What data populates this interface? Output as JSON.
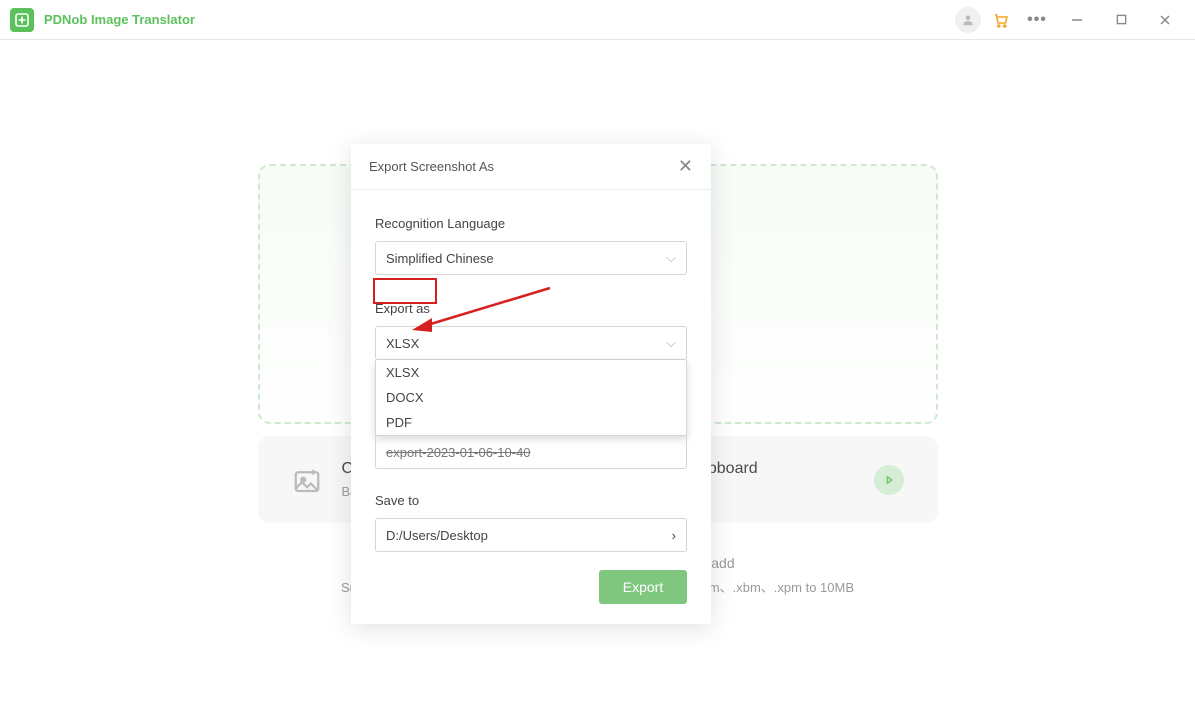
{
  "app": {
    "title": "PDNob Image Translator"
  },
  "main": {
    "click_text": "Click to a",
    "clipboard_text": "clipboard",
    "batch_text": "Batch imp",
    "hint1": "You can directly drag the picture here to add",
    "hint2": "Supproted file types: .jpg、.jpeg、.png、.bmp、.gif、.pbm、.ppm、.xbm、.xpm to 10MB"
  },
  "modal": {
    "title": "Export Screenshot As",
    "recognition_label": "Recognition Language",
    "recognition_value": "Simplified Chinese",
    "export_as_label": "Export as",
    "export_as_value": "XLSX",
    "options": [
      "XLSX",
      "DOCX",
      "PDF"
    ],
    "filename_value": "export-2023-01-06-10-40",
    "save_to_label": "Save to",
    "save_to_value": "D:/Users/Desktop",
    "export_button": "Export"
  }
}
